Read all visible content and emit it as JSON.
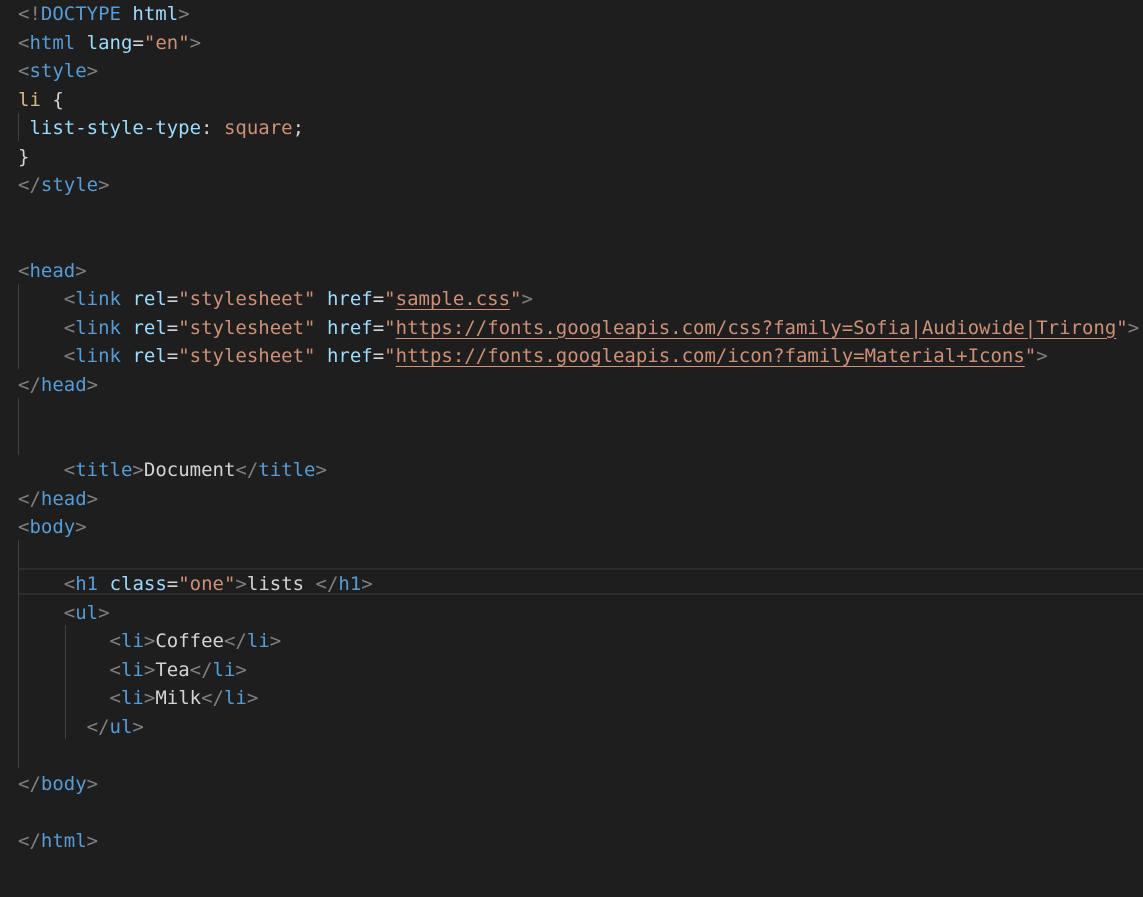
{
  "editor": {
    "theme": "dark",
    "colors": {
      "background": "#1e1e1e",
      "punctuation": "#808080",
      "tag": "#569cd6",
      "attribute": "#9cdcfe",
      "string": "#ce9178",
      "text": "#d4d4d4",
      "selector": "#d7ba7d"
    },
    "lines": [
      [
        [
          "punct",
          "<!"
        ],
        [
          "tag",
          "DOCTYPE"
        ],
        [
          "text",
          " "
        ],
        [
          "attr",
          "html"
        ],
        [
          "punct",
          ">"
        ]
      ],
      [
        [
          "punct",
          "<"
        ],
        [
          "tag",
          "html"
        ],
        [
          "text",
          " "
        ],
        [
          "attr",
          "lang"
        ],
        [
          "text",
          "="
        ],
        [
          "str",
          "\"en\""
        ],
        [
          "punct",
          ">"
        ]
      ],
      [
        [
          "punct",
          "<"
        ],
        [
          "tag",
          "style"
        ],
        [
          "punct",
          ">"
        ]
      ],
      [
        [
          "sel",
          "li"
        ],
        [
          "text",
          " {"
        ]
      ],
      [
        [
          "text",
          " "
        ],
        [
          "prop",
          "list-style-type"
        ],
        [
          "text",
          ": "
        ],
        [
          "str",
          "square"
        ],
        [
          "text",
          ";"
        ]
      ],
      [
        [
          "text",
          "}"
        ]
      ],
      [
        [
          "punct",
          "</"
        ],
        [
          "tag",
          "style"
        ],
        [
          "punct",
          ">"
        ]
      ],
      [],
      [],
      [
        [
          "punct",
          "<"
        ],
        [
          "tag",
          "head"
        ],
        [
          "punct",
          ">"
        ]
      ],
      [
        [
          "text",
          "    "
        ],
        [
          "punct",
          "<"
        ],
        [
          "tag",
          "link"
        ],
        [
          "text",
          " "
        ],
        [
          "attr",
          "rel"
        ],
        [
          "text",
          "="
        ],
        [
          "str",
          "\"stylesheet\""
        ],
        [
          "text",
          " "
        ],
        [
          "attr",
          "href"
        ],
        [
          "text",
          "="
        ],
        [
          "str",
          "\""
        ],
        [
          "link",
          "sample.css"
        ],
        [
          "str",
          "\""
        ],
        [
          "punct",
          ">"
        ]
      ],
      [
        [
          "text",
          "    "
        ],
        [
          "punct",
          "<"
        ],
        [
          "tag",
          "link"
        ],
        [
          "text",
          " "
        ],
        [
          "attr",
          "rel"
        ],
        [
          "text",
          "="
        ],
        [
          "str",
          "\"stylesheet\""
        ],
        [
          "text",
          " "
        ],
        [
          "attr",
          "href"
        ],
        [
          "text",
          "="
        ],
        [
          "str",
          "\""
        ],
        [
          "link",
          "https://fonts.googleapis.com/css?family=Sofia|Audiowide|Trirong"
        ],
        [
          "str",
          "\""
        ],
        [
          "punct",
          ">"
        ]
      ],
      [
        [
          "text",
          "    "
        ],
        [
          "punct",
          "<"
        ],
        [
          "tag",
          "link"
        ],
        [
          "text",
          " "
        ],
        [
          "attr",
          "rel"
        ],
        [
          "text",
          "="
        ],
        [
          "str",
          "\"stylesheet\""
        ],
        [
          "text",
          " "
        ],
        [
          "attr",
          "href"
        ],
        [
          "text",
          "="
        ],
        [
          "str",
          "\""
        ],
        [
          "link",
          "https://fonts.googleapis.com/icon?family=Material+Icons"
        ],
        [
          "str",
          "\""
        ],
        [
          "punct",
          ">"
        ]
      ],
      [
        [
          "punct",
          "</"
        ],
        [
          "tag",
          "head"
        ],
        [
          "punct",
          ">"
        ]
      ],
      [],
      [],
      [
        [
          "text",
          "    "
        ],
        [
          "punct",
          "<"
        ],
        [
          "tag",
          "title"
        ],
        [
          "punct",
          ">"
        ],
        [
          "text",
          "Document"
        ],
        [
          "punct",
          "</"
        ],
        [
          "tag",
          "title"
        ],
        [
          "punct",
          ">"
        ]
      ],
      [
        [
          "punct",
          "</"
        ],
        [
          "tag",
          "head"
        ],
        [
          "punct",
          ">"
        ]
      ],
      [
        [
          "punct",
          "<"
        ],
        [
          "tag",
          "body"
        ],
        [
          "punct",
          ">"
        ]
      ],
      [],
      [
        [
          "text",
          "    "
        ],
        [
          "punct",
          "<"
        ],
        [
          "tag",
          "h1"
        ],
        [
          "text",
          " "
        ],
        [
          "attr",
          "class"
        ],
        [
          "text",
          "="
        ],
        [
          "str",
          "\"one\""
        ],
        [
          "punct",
          ">"
        ],
        [
          "text",
          "lists "
        ],
        [
          "punct",
          "</"
        ],
        [
          "tag",
          "h1"
        ],
        [
          "punct",
          ">"
        ]
      ],
      [
        [
          "text",
          "    "
        ],
        [
          "punct",
          "<"
        ],
        [
          "tag",
          "ul"
        ],
        [
          "punct",
          ">"
        ]
      ],
      [
        [
          "text",
          "        "
        ],
        [
          "punct",
          "<"
        ],
        [
          "tag",
          "li"
        ],
        [
          "punct",
          ">"
        ],
        [
          "text",
          "Coffee"
        ],
        [
          "punct",
          "</"
        ],
        [
          "tag",
          "li"
        ],
        [
          "punct",
          ">"
        ]
      ],
      [
        [
          "text",
          "        "
        ],
        [
          "punct",
          "<"
        ],
        [
          "tag",
          "li"
        ],
        [
          "punct",
          ">"
        ],
        [
          "text",
          "Tea"
        ],
        [
          "punct",
          "</"
        ],
        [
          "tag",
          "li"
        ],
        [
          "punct",
          ">"
        ]
      ],
      [
        [
          "text",
          "        "
        ],
        [
          "punct",
          "<"
        ],
        [
          "tag",
          "li"
        ],
        [
          "punct",
          ">"
        ],
        [
          "text",
          "Milk"
        ],
        [
          "punct",
          "</"
        ],
        [
          "tag",
          "li"
        ],
        [
          "punct",
          ">"
        ]
      ],
      [
        [
          "text",
          "      "
        ],
        [
          "punct",
          "</"
        ],
        [
          "tag",
          "ul"
        ],
        [
          "punct",
          ">"
        ]
      ],
      [],
      [
        [
          "punct",
          "</"
        ],
        [
          "tag",
          "body"
        ],
        [
          "punct",
          ">"
        ]
      ],
      [],
      [
        [
          "punct",
          "</"
        ],
        [
          "tag",
          "html"
        ],
        [
          "punct",
          ">"
        ]
      ]
    ]
  }
}
